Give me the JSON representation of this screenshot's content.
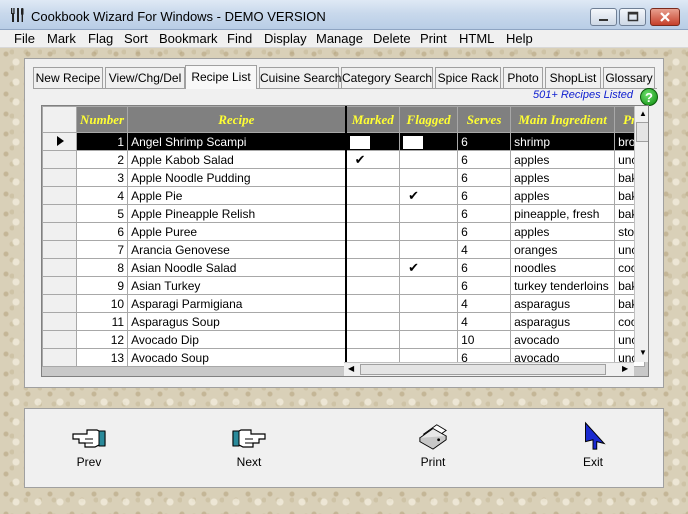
{
  "window": {
    "title": "Cookbook Wizard For Windows - DEMO VERSION"
  },
  "menu": [
    "File",
    "Mark",
    "Flag",
    "Sort",
    "Bookmark",
    "Find",
    "Display",
    "Manage",
    "Delete",
    "Print",
    "HTML",
    "Help"
  ],
  "tabs": [
    {
      "label": "New Recipe",
      "active": false
    },
    {
      "label": "View/Chg/Del",
      "active": false
    },
    {
      "label": "Recipe List",
      "active": true
    },
    {
      "label": "Cuisine Search",
      "active": false
    },
    {
      "label": "Category Search",
      "active": false
    },
    {
      "label": "Spice Rack",
      "active": false
    },
    {
      "label": "Photo",
      "active": false
    },
    {
      "label": "ShopList",
      "active": false
    },
    {
      "label": "Glossary",
      "active": false
    }
  ],
  "recipes_listed": "501+ Recipes Listed",
  "help_icon_text": "?",
  "grid": {
    "columns": [
      "Number",
      "Recipe",
      "Marked",
      "Flagged",
      "Serves",
      "Main Ingredient",
      "Pr"
    ],
    "rows": [
      {
        "num": "1",
        "recipe": "Angel Shrimp Scampi",
        "marked": "",
        "flagged": "",
        "serves": "6",
        "ingredient": "shrimp",
        "pr": "bro"
      },
      {
        "num": "2",
        "recipe": "Apple Kabob Salad",
        "marked": "✔",
        "flagged": "",
        "serves": "6",
        "ingredient": "apples",
        "pr": "unc"
      },
      {
        "num": "3",
        "recipe": "Apple Noodle Pudding",
        "marked": "",
        "flagged": "",
        "serves": "6",
        "ingredient": "apples",
        "pr": "bak"
      },
      {
        "num": "4",
        "recipe": "Apple Pie",
        "marked": "",
        "flagged": "✔",
        "serves": "6",
        "ingredient": "apples",
        "pr": "bak"
      },
      {
        "num": "5",
        "recipe": "Apple Pineapple Relish",
        "marked": "",
        "flagged": "",
        "serves": "6",
        "ingredient": "pineapple, fresh",
        "pr": "bak"
      },
      {
        "num": "6",
        "recipe": "Apple Puree",
        "marked": "",
        "flagged": "",
        "serves": "6",
        "ingredient": "apples",
        "pr": "sto"
      },
      {
        "num": "7",
        "recipe": "Arancia Genovese",
        "marked": "",
        "flagged": "",
        "serves": "4",
        "ingredient": "oranges",
        "pr": "unc"
      },
      {
        "num": "8",
        "recipe": "Asian Noodle Salad",
        "marked": "",
        "flagged": "✔",
        "serves": "6",
        "ingredient": "noodles",
        "pr": "coc"
      },
      {
        "num": "9",
        "recipe": "Asian Turkey",
        "marked": "",
        "flagged": "",
        "serves": "6",
        "ingredient": "turkey tenderloins",
        "pr": "bak"
      },
      {
        "num": "10",
        "recipe": "Asparagi Parmigiana",
        "marked": "",
        "flagged": "",
        "serves": "4",
        "ingredient": "asparagus",
        "pr": "bak"
      },
      {
        "num": "11",
        "recipe": "Asparagus Soup",
        "marked": "",
        "flagged": "",
        "serves": "4",
        "ingredient": "asparagus",
        "pr": "coc"
      },
      {
        "num": "12",
        "recipe": "Avocado Dip",
        "marked": "",
        "flagged": "",
        "serves": "10",
        "ingredient": "avocado",
        "pr": "unc"
      },
      {
        "num": "13",
        "recipe": "Avocado Soup",
        "marked": "",
        "flagged": "",
        "serves": "6",
        "ingredient": "avocado",
        "pr": "unc"
      }
    ]
  },
  "buttons": {
    "prev": "Prev",
    "next": "Next",
    "print": "Print",
    "exit": "Exit"
  }
}
